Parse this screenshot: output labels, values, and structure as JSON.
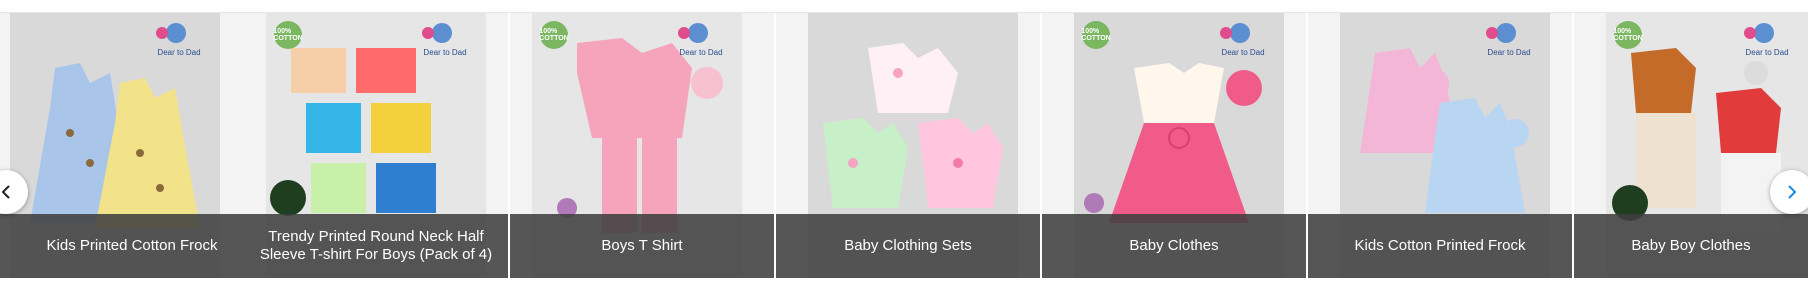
{
  "products": [
    {
      "name": "Kids Printed Cotton Frock",
      "badge": ""
    },
    {
      "name": "Trendy Printed Round Neck Half Sleeve T-shirt For Boys (Pack of 4)",
      "badge": "100% COTTON"
    },
    {
      "name": "Boys T Shirt",
      "badge": "100% COTTON"
    },
    {
      "name": "Baby Clothing Sets",
      "badge": ""
    },
    {
      "name": "Baby Clothes",
      "badge": "100% COTTON"
    },
    {
      "name": "Kids Cotton Printed Frock",
      "badge": ""
    },
    {
      "name": "Baby Boy Clothes",
      "badge": "100% COTTON"
    }
  ],
  "brand": "Dear to Dad",
  "nav": {
    "prev_icon": "chevron-left-icon",
    "next_icon": "chevron-right-icon"
  }
}
